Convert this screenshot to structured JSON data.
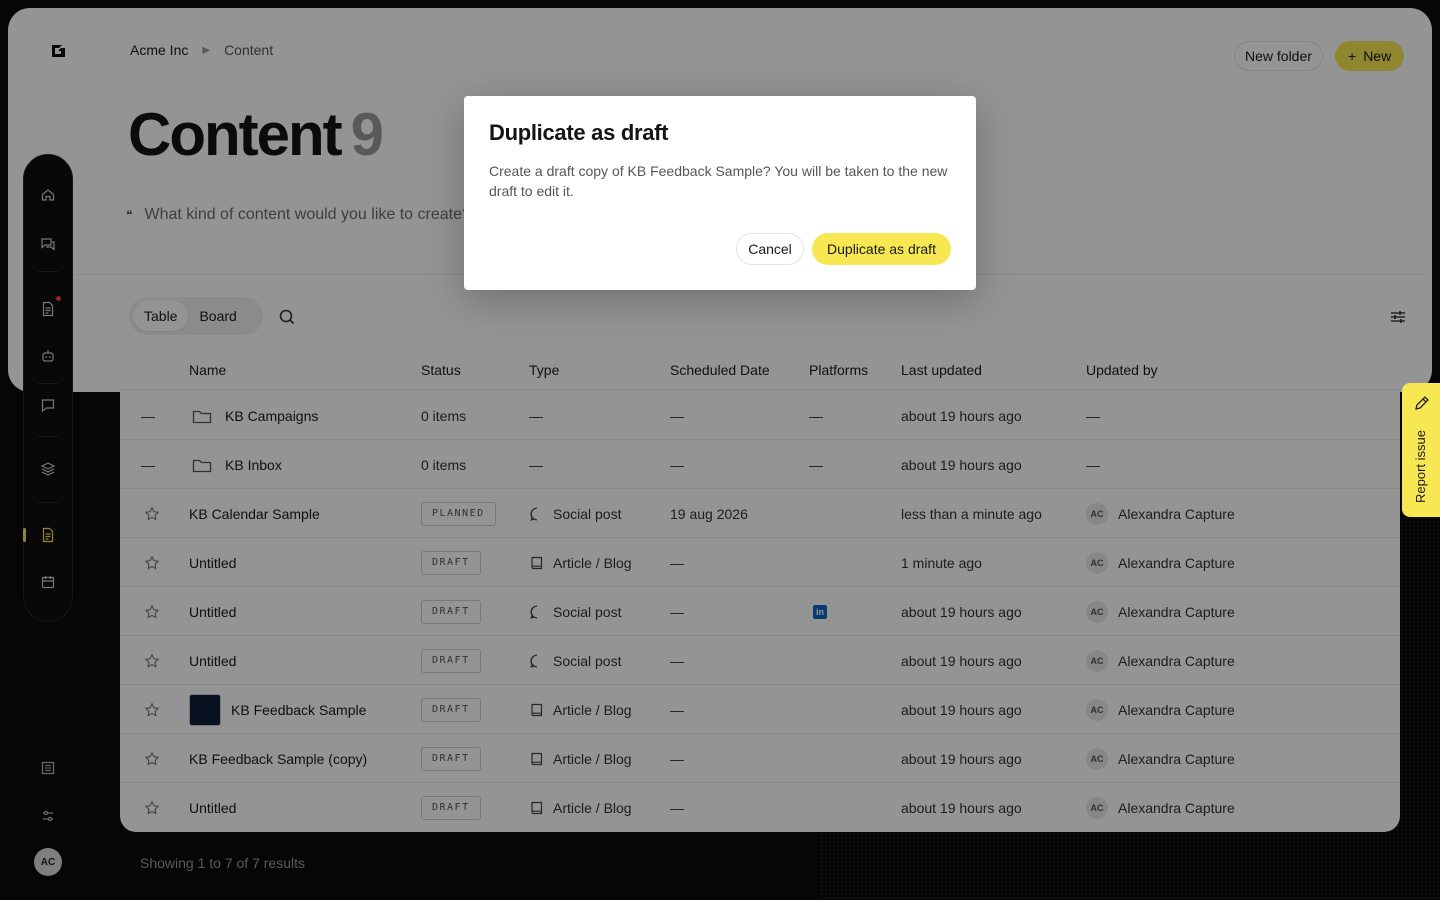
{
  "header": {
    "org": "Acme Inc",
    "breadcrumb_current": "Content",
    "new_folder_label": "New folder",
    "new_label": "New",
    "title": "Content",
    "count": "9",
    "prompt_placeholder": "What kind of content would you like to create?"
  },
  "toolbar": {
    "view_table": "Table",
    "view_board": "Board",
    "active_view": "Table"
  },
  "table": {
    "columns": [
      "Name",
      "Status",
      "Type",
      "Scheduled Date",
      "Platforms",
      "Last updated",
      "Updated by"
    ],
    "rows": [
      {
        "kind": "folder",
        "lead": "—",
        "name": "KB Campaigns",
        "status": "0 items",
        "type": "—",
        "date": "—",
        "platforms": "—",
        "updated": "about 19 hours ago",
        "by": "—"
      },
      {
        "kind": "folder",
        "lead": "—",
        "name": "KB Inbox",
        "status": "0 items",
        "type": "—",
        "date": "—",
        "platforms": "—",
        "updated": "about 19 hours ago",
        "by": "—"
      },
      {
        "kind": "item",
        "name": "KB Calendar Sample",
        "status": "PLANNED",
        "type": "Social post",
        "type_icon": "chat",
        "date": "19 aug 2026",
        "platforms": "",
        "updated": "less than a minute ago",
        "by_initials": "AC",
        "by": "Alexandra Capture"
      },
      {
        "kind": "item",
        "name": "Untitled",
        "status": "DRAFT",
        "type": "Article / Blog",
        "type_icon": "book",
        "date": "—",
        "platforms": "",
        "updated": "1 minute ago",
        "by_initials": "AC",
        "by": "Alexandra Capture"
      },
      {
        "kind": "item",
        "name": "Untitled",
        "status": "DRAFT",
        "type": "Social post",
        "type_icon": "chat",
        "date": "—",
        "platforms": "linkedin",
        "updated": "about 19 hours ago",
        "by_initials": "AC",
        "by": "Alexandra Capture"
      },
      {
        "kind": "item",
        "name": "Untitled",
        "status": "DRAFT",
        "type": "Social post",
        "type_icon": "chat",
        "date": "—",
        "platforms": "",
        "updated": "about 19 hours ago",
        "by_initials": "AC",
        "by": "Alexandra Capture"
      },
      {
        "kind": "item",
        "thumb": true,
        "name": "KB Feedback Sample",
        "status": "DRAFT",
        "type": "Article / Blog",
        "type_icon": "book",
        "date": "—",
        "platforms": "",
        "updated": "about 19 hours ago",
        "by_initials": "AC",
        "by": "Alexandra Capture"
      },
      {
        "kind": "item",
        "name": "KB Feedback Sample (copy)",
        "status": "DRAFT",
        "type": "Article / Blog",
        "type_icon": "book",
        "date": "—",
        "platforms": "",
        "updated": "about 19 hours ago",
        "by_initials": "AC",
        "by": "Alexandra Capture"
      },
      {
        "kind": "item",
        "name": "Untitled",
        "status": "DRAFT",
        "type": "Article / Blog",
        "type_icon": "book",
        "date": "—",
        "platforms": "",
        "updated": "about 19 hours ago",
        "by_initials": "AC",
        "by": "Alexandra Capture"
      }
    ]
  },
  "footer": {
    "results": "Showing 1 to 7 of 7 results"
  },
  "sidebar": {
    "items": [
      "home-icon",
      "chat-stack-icon",
      "document-icon",
      "bot-icon",
      "message-icon",
      "layers-icon",
      "content-icon",
      "calendar-icon"
    ],
    "bottom": [
      "newspaper-icon",
      "sliders-icon"
    ],
    "user_initials": "AC"
  },
  "report": {
    "label": "Report issue"
  },
  "modal": {
    "title": "Duplicate as draft",
    "description": "Create a draft copy of KB Feedback Sample? You will be taken to the new draft to edit it.",
    "cancel_label": "Cancel",
    "confirm_label": "Duplicate as draft"
  },
  "colors": {
    "accent": "#f7e752",
    "background": "#0b0b0b",
    "linkedin": "#0a66c2"
  }
}
